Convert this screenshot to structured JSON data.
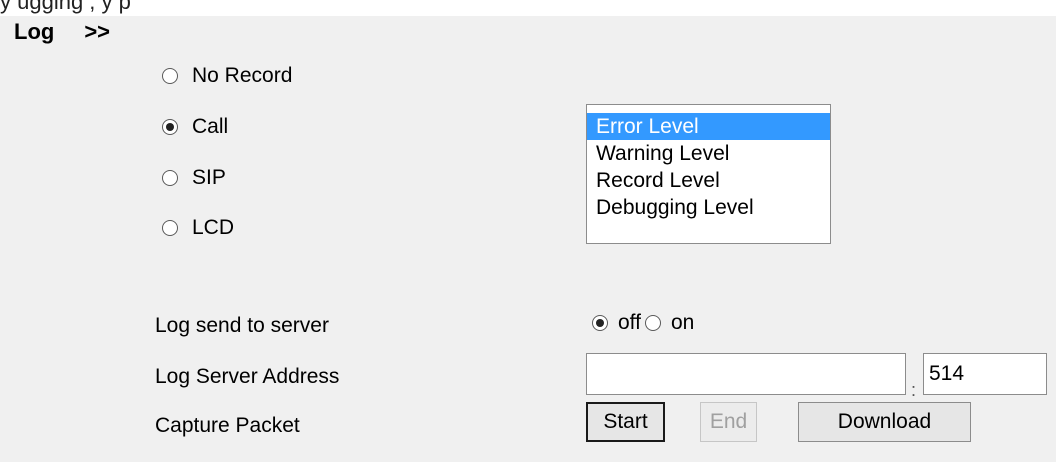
{
  "top_strip_text": "y                                  ugging   ,  y                     p",
  "header": {
    "title": "Log",
    "arrows": ">>"
  },
  "log_types": [
    {
      "label": "No Record",
      "checked": false
    },
    {
      "label": "Call",
      "checked": true
    },
    {
      "label": "SIP",
      "checked": false
    },
    {
      "label": "LCD",
      "checked": false
    }
  ],
  "levels": {
    "options": [
      "Error Level",
      "Warning Level",
      "Record Level",
      "Debugging Level"
    ],
    "selected": "Error Level"
  },
  "send_to_server": {
    "label": "Log send to server",
    "off_label": "off",
    "on_label": "on",
    "selected": "off"
  },
  "server_address": {
    "label": "Log Server Address",
    "value": "",
    "separator": ":",
    "port": "514"
  },
  "capture": {
    "label": "Capture Packet",
    "start_label": "Start",
    "end_label": "End",
    "download_label": "Download"
  },
  "colors": {
    "panel_bg": "#f0f0f0",
    "selection_bg": "#3399ff"
  }
}
